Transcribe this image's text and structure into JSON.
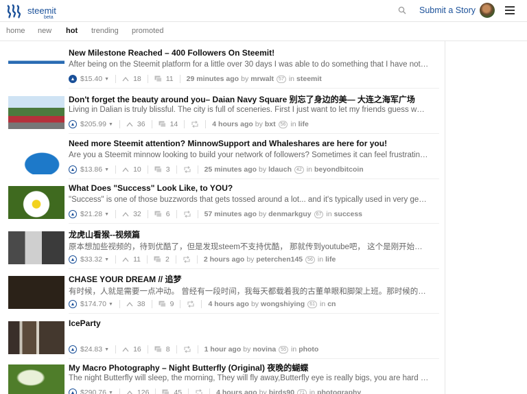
{
  "header": {
    "logo_name": "steemit",
    "logo_badge": "beta",
    "submit_label": "Submit a Story"
  },
  "subnav": {
    "items": [
      {
        "label": "home"
      },
      {
        "label": "new"
      },
      {
        "label": "hot"
      },
      {
        "label": "trending"
      },
      {
        "label": "promoted"
      }
    ],
    "active": "hot"
  },
  "posts": [
    {
      "title": "New Milestone Reached – 400 Followers On Steemit!",
      "excerpt": "After being on the Steemit platform for a little over 30 days I was able to do something that I have not been able to do on other platforms.",
      "payout": "$15.40",
      "votes": "18",
      "comments": "11",
      "time": "29 minutes ago",
      "by": "by",
      "author": "mrwalt",
      "rep": "57",
      "in": "in",
      "category": "steemit",
      "voted": true,
      "reblog": false
    },
    {
      "title": "Don't forget the beauty around you– Daian Navy Square 别忘了身边的美— 大连之海军广场",
      "excerpt": "Living in Dalian is truly blissful. The city is full of sceneries. First I just want to let my friends guess which place this is.",
      "payout": "$205.99",
      "votes": "36",
      "comments": "14",
      "time": "4 hours ago",
      "by": "by",
      "author": "bxt",
      "rep": "56",
      "in": "in",
      "category": "life",
      "voted": false,
      "reblog": true
    },
    {
      "title": "Need more Steemit attention? MinnowSupport and Whaleshares are here for you!",
      "excerpt": "Are you a Steemit minnow looking to build your network of followers? Sometimes it can feel frustrating to write great content and get no attention.",
      "payout": "$13.86",
      "votes": "10",
      "comments": "3",
      "time": "25 minutes ago",
      "by": "by",
      "author": "ldauch",
      "rep": "42",
      "in": "in",
      "category": "beyondbitcoin",
      "voted": false,
      "reblog": true
    },
    {
      "title": "What Does \"Success\" Look Like, to YOU?",
      "excerpt": "\"Success\" is one of those buzzwords that gets tossed around a lot... and it's typically used in very general and vague terms.",
      "payout": "$21.28",
      "votes": "32",
      "comments": "6",
      "time": "57 minutes ago",
      "by": "by",
      "author": "denmarkguy",
      "rep": "67",
      "in": "in",
      "category": "success",
      "voted": false,
      "reblog": true
    },
    {
      "title": "龙虎山看猴--视频篇",
      "excerpt": "原本想加些视频的，待到优酷了，但是发现steem不支持优酷， 那就传到youtube吧， 这个是刚开始的 喂一下猴子",
      "payout": "$33.32",
      "votes": "11",
      "comments": "2",
      "time": "2 hours ago",
      "by": "by",
      "author": "peterchen145",
      "rep": "56",
      "in": "in",
      "category": "life",
      "voted": false,
      "reblog": true
    },
    {
      "title": "CHASE YOUR DREAM // 追梦",
      "excerpt": "有时候，人就是需要一点冲动。 曾经有一段时间，我每天都载着我的古董单眼和脚架上班。那时候的下班时间很早",
      "payout": "$174.70",
      "votes": "38",
      "comments": "9",
      "time": "4 hours ago",
      "by": "by",
      "author": "wongshiying",
      "rep": "61",
      "in": "in",
      "category": "cn",
      "voted": false,
      "reblog": true
    },
    {
      "title": "IceParty",
      "excerpt": "",
      "payout": "$24.83",
      "votes": "16",
      "comments": "8",
      "time": "1 hour ago",
      "by": "by",
      "author": "novina",
      "rep": "55",
      "in": "in",
      "category": "photo",
      "voted": false,
      "reblog": true
    },
    {
      "title": "My Macro Photography – Night Butterfly (Original) 夜晚的蝴蝶",
      "excerpt": "The night Butterfly will sleep, the morning, They will fly away,Butterfly eye is really bigs, you are hard to close to them.",
      "payout": "$290.76",
      "votes": "126",
      "comments": "45",
      "time": "4 hours ago",
      "by": "by",
      "author": "birds90",
      "rep": "71",
      "in": "in",
      "category": "photography",
      "voted": false,
      "reblog": true
    }
  ],
  "colors": {
    "brand": "#1a5099",
    "text_muted": "#999999",
    "divider": "#e6e6e6"
  }
}
